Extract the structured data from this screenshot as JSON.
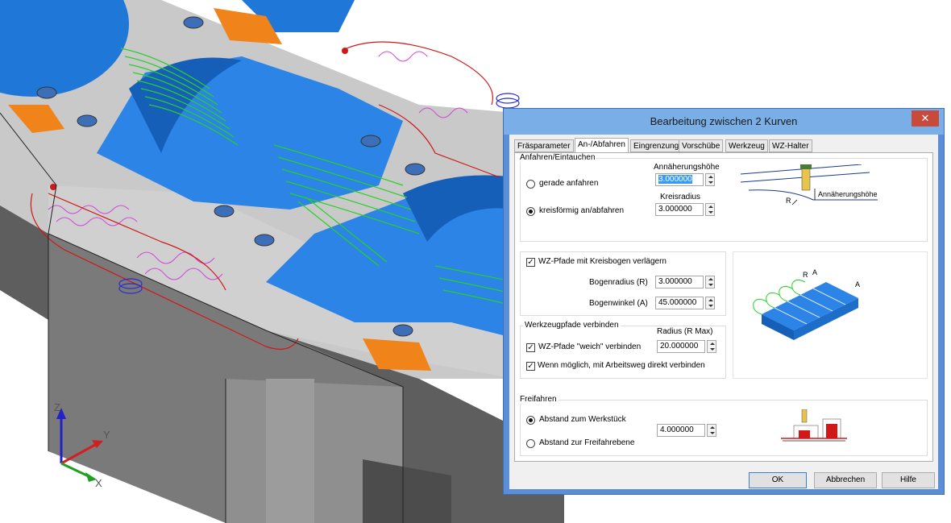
{
  "dialog": {
    "title": "Bearbeitung zwischen 2 Kurven",
    "close_glyph": "✕",
    "tabs": [
      "Fräsparameter",
      "An-/Abfahren",
      "Eingrenzung",
      "Vorschübe",
      "Werkzeug",
      "WZ-Halter"
    ],
    "active_tab": "An-/Abfahren",
    "approach": {
      "group_label": "Anfahren/Eintauchen",
      "height_label": "Annäherungshöhe",
      "height_value": "3.000000",
      "radius_label": "Kreisradius",
      "radius_value": "3.000000",
      "option_straight": "gerade anfahren",
      "option_circular": "kreisförmig an/abfahren",
      "selected": "circular",
      "diagram_label_height": "Annäherungshöhe",
      "diagram_label_r": "R"
    },
    "arc": {
      "checkbox_label": "WZ-Pfade mit Kreisbogen verlägern",
      "checked": true,
      "radius_label": "Bogenradius (R)",
      "radius_value": "3.000000",
      "angle_label": "Bogenwinkel (A)",
      "angle_value": "45.000000",
      "diagram_label_r": "R",
      "diagram_label_a": "A"
    },
    "connect": {
      "group_label": "Werkzeugpfade verbinden",
      "radius_label": "Radius (R Max)",
      "soft_label": "WZ-Pfade \"weich\" verbinden",
      "soft_checked": true,
      "soft_value": "20.000000",
      "direct_label": "Wenn möglich, mit  Arbeitsweg direkt verbinden",
      "direct_checked": true
    },
    "retract": {
      "group_label": "Freifahren",
      "option_workpiece": "Abstand zum Werkstück",
      "option_plane": "Abstand zur Freifahrebene",
      "selected": "workpiece",
      "value": "4.000000"
    },
    "buttons": {
      "ok": "OK",
      "cancel": "Abbrechen",
      "help": "Hilfe"
    },
    "check_glyph": "✓"
  },
  "axes": {
    "z": "Z",
    "y": "Y",
    "x": "X"
  },
  "colors": {
    "part_blue": "#1f78d8",
    "part_grey": "#c8c8c8",
    "pocket_orange": "#f0841a",
    "toolpath_green": "#28d028",
    "toolpath_magenta": "#d048d8",
    "boundary_red": "#d01818",
    "titlebar": "#7aaee6",
    "close_red": "#c74a3b"
  }
}
